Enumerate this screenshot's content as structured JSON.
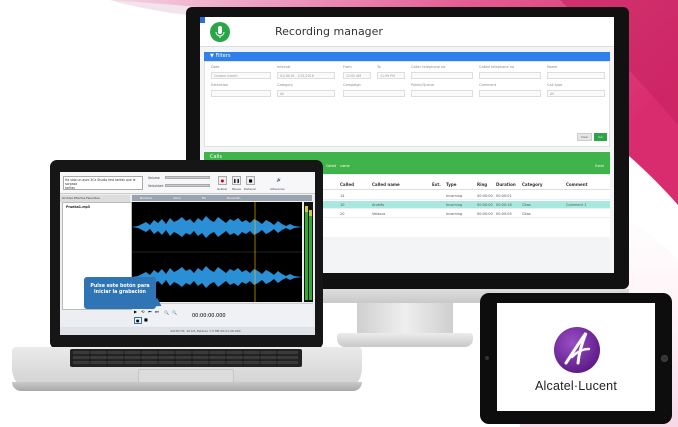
{
  "colors": {
    "filters_blue": "#2f80ed",
    "calls_green": "#3fb44a",
    "row_highlight": "#a9e8de",
    "mic_green": "#2aa648",
    "waveform_blue": "#2b8fd6",
    "tooltip_blue": "#2f74b5",
    "alcatel_purple": "#6a1f93",
    "swoosh_magenta": "#d92c6e"
  },
  "monitor": {
    "app_title": "Recording manager",
    "filters": {
      "bar_label": "Filters",
      "fields": [
        {
          "label": "Date",
          "value": "Custom month"
        },
        {
          "label": "Interval",
          "value": "01/18/16 - 1/31/2016"
        },
        {
          "label": "From",
          "value": "12:00 AM"
        },
        {
          "label": "To",
          "value": "11:59 PM"
        },
        {
          "label": "Caller telephone no",
          "value": ""
        },
        {
          "label": "Called telephone no",
          "value": ""
        },
        {
          "label": "Name",
          "value": ""
        },
        {
          "label": "Extension",
          "value": ""
        },
        {
          "label": "Category",
          "value": "All"
        },
        {
          "label": "Campaign",
          "value": ""
        },
        {
          "label": "Public/Queue",
          "value": ""
        },
        {
          "label": "Comment",
          "value": ""
        },
        {
          "label": "Call type",
          "value": "All"
        }
      ],
      "clear_label": "Clear",
      "go_label": "Go"
    },
    "calls": {
      "bar_label": "Calls",
      "toolbar": "Play  Save  Email  Verify  Category  Comment  Caller name  Called name",
      "hits_label": "Excel",
      "headers": [
        "Called",
        "Called name",
        "Ext.",
        "Type",
        "Ring",
        "Duration",
        "Category",
        "Comment"
      ],
      "rows": [
        [
          "14",
          "",
          "",
          "Incoming",
          "00:00:00",
          "00:00:01",
          "",
          ""
        ],
        [
          "10",
          "Andrés",
          "",
          "Incoming",
          "00:00:00",
          "00:00:16",
          "Citas",
          "Comment 1"
        ],
        [
          "20",
          "Velasco",
          "",
          "Incoming",
          "00:00:00",
          "00:00:05",
          "Citas",
          ""
        ]
      ]
    }
  },
  "laptop": {
    "editor": {
      "message": "Ha sido un auto 3Cx Studio test tarifas que le sorpasa",
      "message_line2": "tarifas",
      "volume_label": "Volume",
      "speed_label": "Velocidad",
      "buttons": [
        "Grabar",
        "Pausa",
        "Detener"
      ],
      "spkr_label": "Altavoces",
      "tabs": "Archivo   Efectos   Favoritos",
      "file_name": "Prueba1.mp3",
      "wave_header": "Nombre   Inicio   Fin   Duración",
      "tooltip": "Pulse este botón para iniciar la grabación",
      "time_display": "00:00:00.000",
      "status_bar": "44100 Hz, 16 bit, Estéreo     1.5 MB     00:01:26.000"
    }
  },
  "tablet": {
    "brand_text": "Alcatel·Lucent"
  }
}
